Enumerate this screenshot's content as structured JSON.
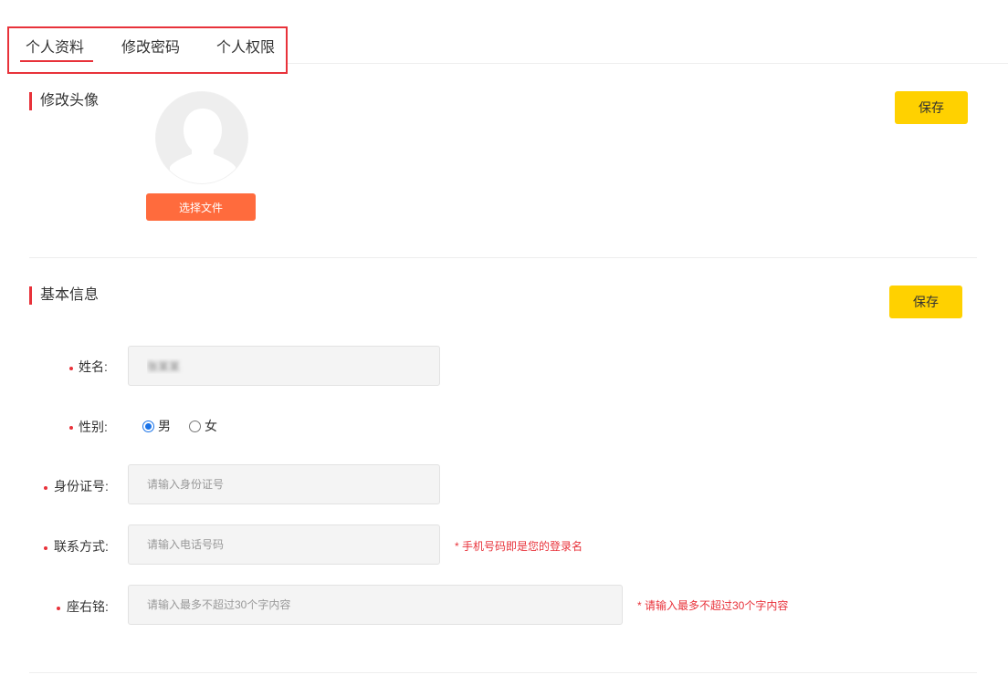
{
  "tabs": [
    {
      "label": "个人资料",
      "active": true
    },
    {
      "label": "修改密码",
      "active": false
    },
    {
      "label": "个人权限",
      "active": false
    }
  ],
  "avatar_section": {
    "title": "修改头像",
    "choose_file_label": "选择文件",
    "save_label": "保存"
  },
  "basic_section": {
    "title": "基本信息",
    "save_label": "保存"
  },
  "form": {
    "name": {
      "label": "姓名:",
      "value": "张某某"
    },
    "gender": {
      "label": "性别:",
      "options": [
        "男",
        "女"
      ],
      "selected": "男"
    },
    "id_card": {
      "label": "身份证号:",
      "placeholder": "请输入身份证号"
    },
    "contact": {
      "label": "联系方式:",
      "placeholder": "请输入电话号码",
      "hint": "* 手机号码即是您的登录名"
    },
    "motto": {
      "label": "座右铭:",
      "placeholder": "请输入最多不超过30个字内容",
      "hint": "* 请输入最多不超过30个字内容"
    }
  },
  "colors": {
    "accent_red": "#e8323a",
    "save_yellow": "#ffd100",
    "choose_orange": "#ff6b3d"
  }
}
